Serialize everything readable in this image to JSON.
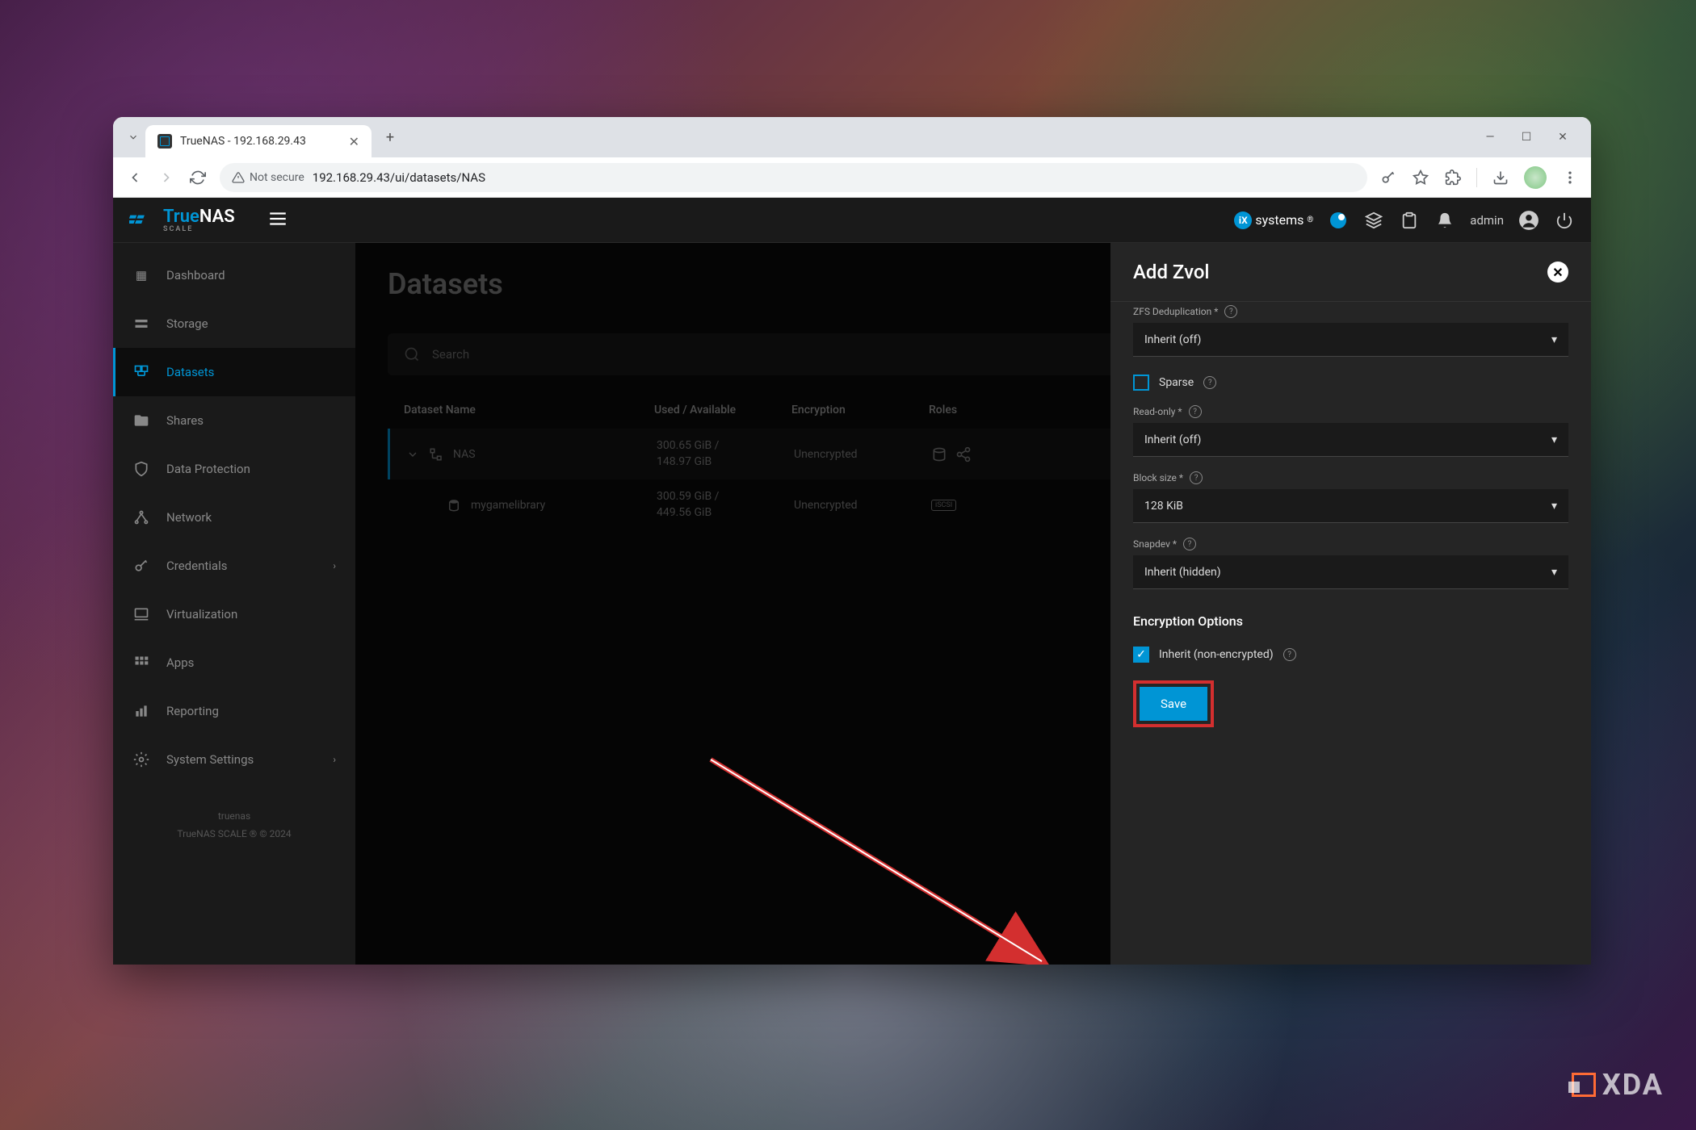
{
  "browser": {
    "tab_title": "TrueNAS - 192.168.29.43",
    "security_label": "Not secure",
    "url": "192.168.29.43/ui/datasets/NAS"
  },
  "topbar": {
    "brand_true": "True",
    "brand_nas": "NAS",
    "brand_scale": "SCALE",
    "ix_label": "systems",
    "admin_label": "admin"
  },
  "sidebar": {
    "items": [
      {
        "label": "Dashboard",
        "icon": "dashboard"
      },
      {
        "label": "Storage",
        "icon": "storage"
      },
      {
        "label": "Datasets",
        "icon": "datasets",
        "active": true
      },
      {
        "label": "Shares",
        "icon": "shares"
      },
      {
        "label": "Data Protection",
        "icon": "shield"
      },
      {
        "label": "Network",
        "icon": "network"
      },
      {
        "label": "Credentials",
        "icon": "key",
        "expandable": true
      },
      {
        "label": "Virtualization",
        "icon": "laptop"
      },
      {
        "label": "Apps",
        "icon": "apps"
      },
      {
        "label": "Reporting",
        "icon": "chart"
      },
      {
        "label": "System Settings",
        "icon": "gear",
        "expandable": true
      }
    ],
    "footer_host": "truenas",
    "footer_copy": "TrueNAS SCALE ® © 2024"
  },
  "main": {
    "title": "Datasets",
    "search_placeholder": "Search",
    "columns": {
      "name": "Dataset Name",
      "used": "Used / Available",
      "enc": "Encryption",
      "roles": "Roles"
    },
    "rows": [
      {
        "name": "NAS",
        "used_a": "300.65 GiB /",
        "used_b": "148.97 GiB",
        "enc": "Unencrypted",
        "selected": true
      },
      {
        "name": "mygamelibrary",
        "used_a": "300.59 GiB /",
        "used_b": "449.56 GiB",
        "enc": "Unencrypted",
        "child": true
      }
    ]
  },
  "panel": {
    "title": "Add Zvol",
    "dedup_label": "ZFS Deduplication *",
    "dedup_value": "Inherit (off)",
    "sparse_label": "Sparse",
    "readonly_label": "Read-only *",
    "readonly_value": "Inherit (off)",
    "blocksize_label": "Block size *",
    "blocksize_value": "128 KiB",
    "snapdev_label": "Snapdev *",
    "snapdev_value": "Inherit (hidden)",
    "encryption_title": "Encryption Options",
    "inherit_enc_label": "Inherit (non-encrypted)",
    "save_label": "Save"
  },
  "watermark": "XDA"
}
